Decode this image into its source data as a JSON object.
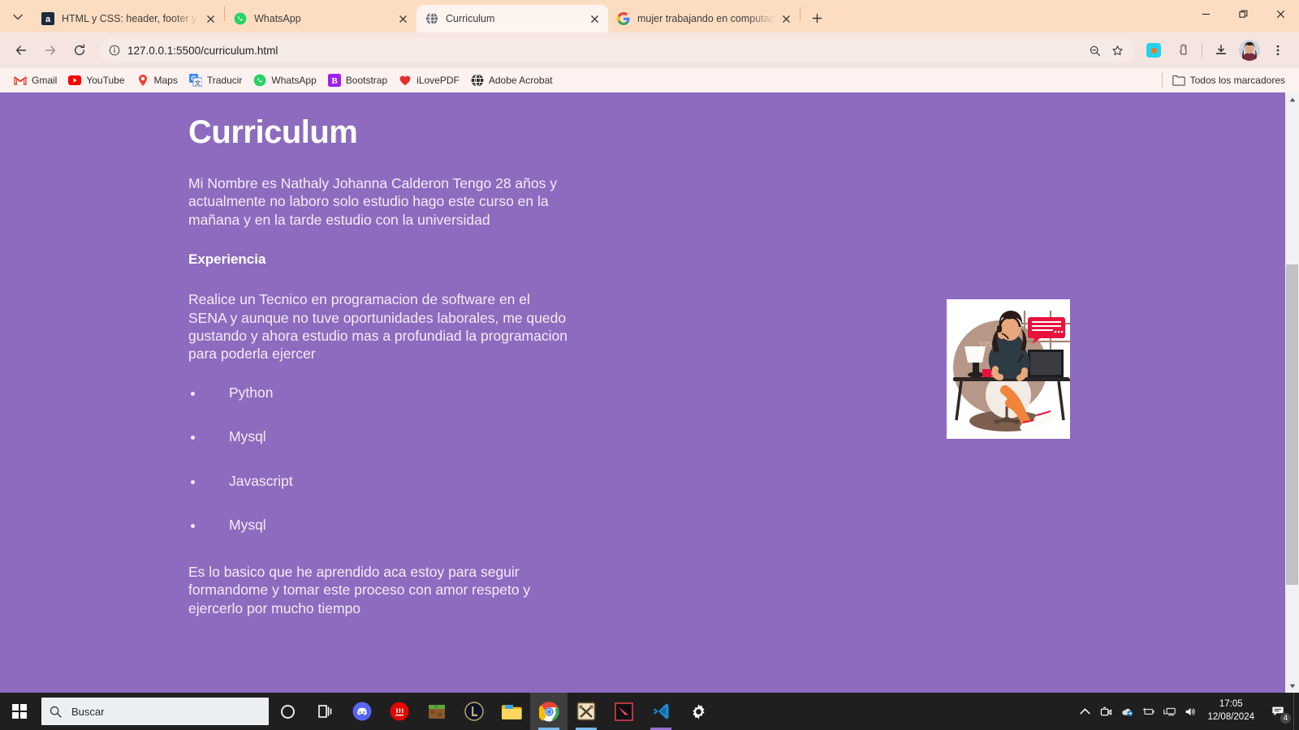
{
  "browser": {
    "tab_search_icon": "chevron-down-icon",
    "tabs": [
      {
        "title": "HTML y CSS: header, footer y va",
        "favicon": "alura-icon",
        "active": false
      },
      {
        "title": "WhatsApp",
        "favicon": "whatsapp-icon",
        "active": false
      },
      {
        "title": "Curriculum",
        "favicon": "globe-icon",
        "active": true
      },
      {
        "title": "mujer trabajando en computad",
        "favicon": "google-icon",
        "active": false
      }
    ],
    "new_tab_label": "+",
    "window_controls": {
      "minimize": "minimize-icon",
      "maximize": "restore-icon",
      "close": "close-icon"
    },
    "toolbar": {
      "back": "back-arrow-icon",
      "forward": "forward-arrow-icon",
      "reload": "reload-icon",
      "site_info": "info-icon",
      "url": "127.0.0.1:5500/curriculum.html",
      "zoom_out": "zoom-out-icon",
      "bookmark_star": "star-icon",
      "extension_active": "extension-color-icon",
      "extensions": "puzzle-icon",
      "downloads": "download-icon",
      "profile": "profile-avatar",
      "menu": "three-dot-menu-icon"
    },
    "bookmarks": [
      {
        "label": "Gmail",
        "icon": "gmail-icon"
      },
      {
        "label": "YouTube",
        "icon": "youtube-icon"
      },
      {
        "label": "Maps",
        "icon": "maps-pin-icon"
      },
      {
        "label": "Traducir",
        "icon": "google-translate-icon"
      },
      {
        "label": "WhatsApp",
        "icon": "whatsapp-icon"
      },
      {
        "label": "Bootstrap",
        "icon": "bootstrap-icon"
      },
      {
        "label": "iLovePDF",
        "icon": "ilovepdf-heart-icon"
      },
      {
        "label": "Adobe Acrobat",
        "icon": "adobe-acrobat-icon"
      }
    ],
    "all_bookmarks": {
      "label": "Todos los marcadores",
      "icon": "folder-icon"
    }
  },
  "page": {
    "background_color": "#8d6bbe",
    "text_color": "#f3ecfa",
    "heading": "Curriculum",
    "intro": "Mi Nombre es Nathaly Johanna Calderon Tengo 28 años y actualmente no laboro solo estudio hago este curso en la mañana y en la tarde estudio con la universidad",
    "section_title": "Experiencia",
    "experience": "Realice un Tecnico en programacion de software en el SENA y aunque no tuve oportunidades laborales, me quedo gustando y ahora estudio mas a profundiad la programacion para poderla ejercer",
    "skills": [
      "Python",
      "Mysql",
      "Javascript",
      "Mysql"
    ],
    "closing": "Es lo basico que he aprendido aca estoy para seguir formandome y tomar este proceso con amor respeto y ejercerlo por mucho tiempo",
    "illustration_alt": "mujer trabajando en computadora ilustracion"
  },
  "taskbar": {
    "start": "windows-start-icon",
    "search_placeholder": "Buscar",
    "search_icon": "search-icon",
    "cortana": "cortana-icon",
    "apps": [
      {
        "name": "task-view",
        "icon": "task-view-icon"
      },
      {
        "name": "discord",
        "icon": "discord-icon"
      },
      {
        "name": "wild-rift",
        "icon": "wild-rift-icon"
      },
      {
        "name": "minecraft",
        "icon": "minecraft-icon"
      },
      {
        "name": "league-of-legends",
        "icon": "league-of-legends-icon"
      },
      {
        "name": "file-explorer",
        "icon": "file-explorer-icon"
      },
      {
        "name": "google-chrome",
        "icon": "chrome-icon"
      },
      {
        "name": "world-of-warcraft",
        "icon": "wow-icon"
      },
      {
        "name": "valorant",
        "icon": "valorant-icon"
      },
      {
        "name": "visual-studio-code",
        "icon": "vscode-icon"
      },
      {
        "name": "settings",
        "icon": "gear-icon"
      }
    ],
    "tray": {
      "show_hidden": "chevron-up-icon",
      "camera": "camera-icon",
      "onedrive": "onedrive-icon",
      "battery": "battery-icon",
      "network": "network-display-icon",
      "volume": "volume-icon",
      "time": "17:05",
      "date": "12/08/2024",
      "notifications_icon": "notification-icon",
      "notifications_count": "4"
    }
  }
}
